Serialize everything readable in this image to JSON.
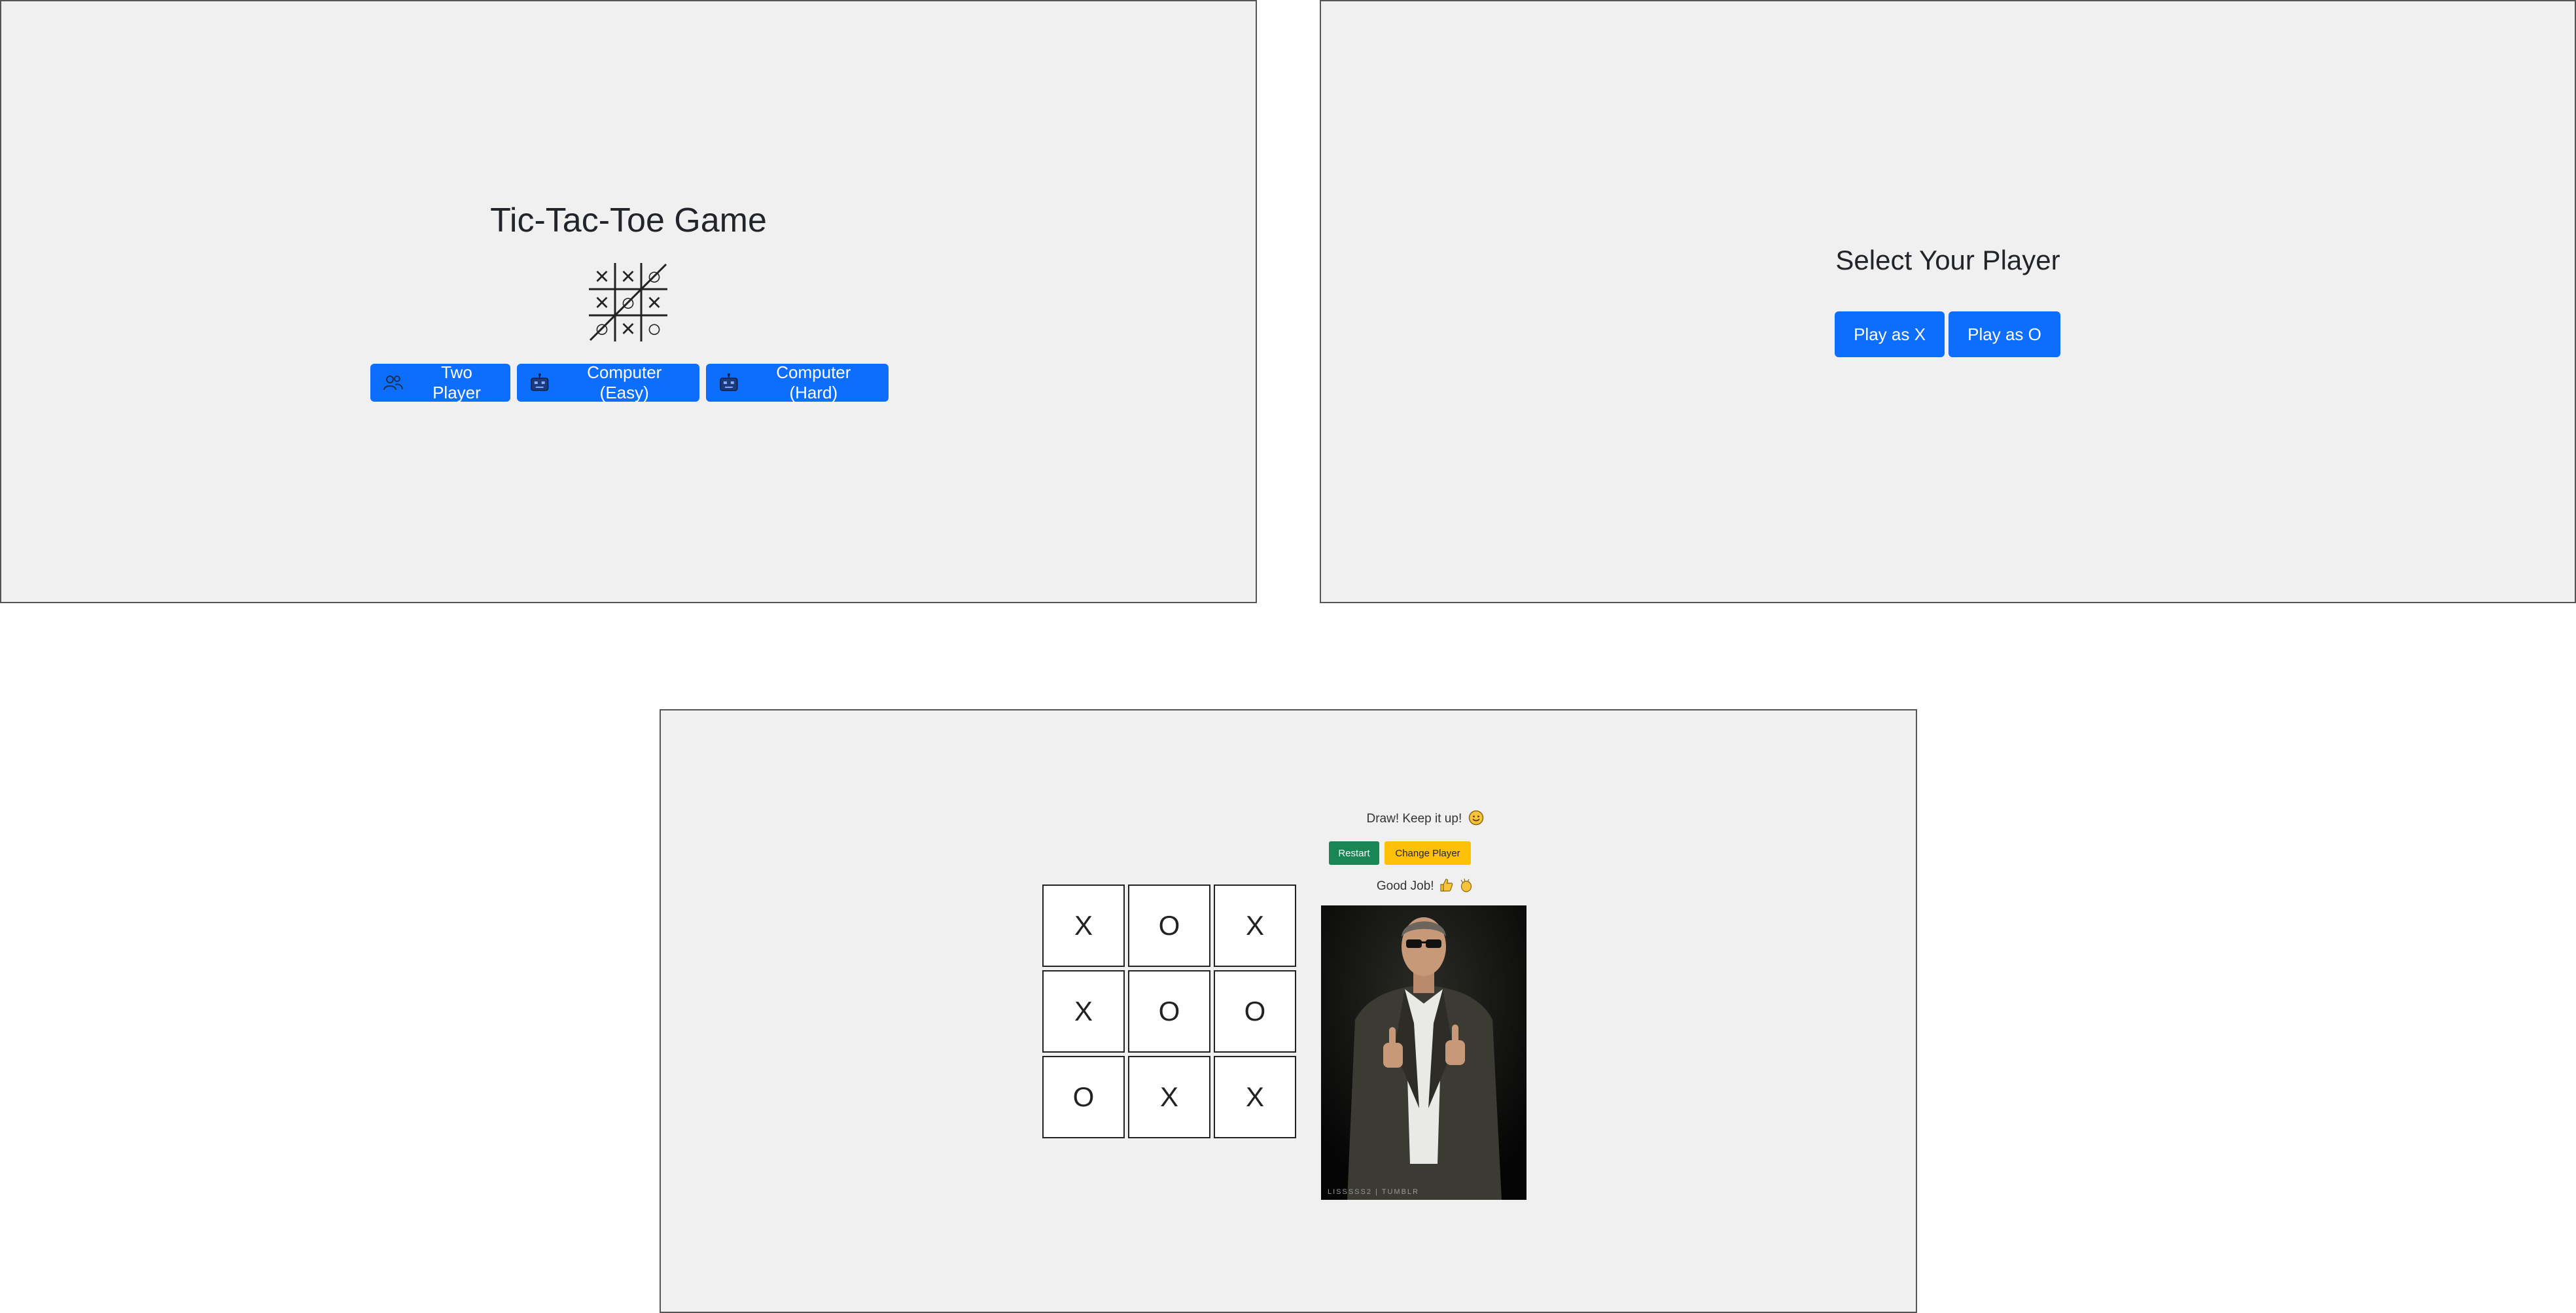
{
  "menu": {
    "title": "Tic-Tac-Toe Game",
    "logo_marks": [
      "×",
      "×",
      "○",
      "×",
      "○",
      "×",
      "○",
      "×",
      "○"
    ],
    "buttons": {
      "two_player": "Two Player",
      "computer_easy": "Computer (Easy)",
      "computer_hard": "Computer (Hard)"
    },
    "icons": {
      "two_player": "users-icon",
      "computer_easy": "robot-icon",
      "computer_hard": "robot-icon"
    }
  },
  "select": {
    "title": "Select Your Player",
    "play_x": "Play as X",
    "play_o": "Play as O"
  },
  "game": {
    "board": [
      "X",
      "O",
      "X",
      "X",
      "O",
      "O",
      "O",
      "X",
      "X"
    ],
    "status": "Draw! Keep it up!",
    "status_emoji": "smiling-face",
    "restart_label": "Restart",
    "change_player_label": "Change Player",
    "praise": "Good Job!",
    "praise_emojis": [
      "thumbs-up",
      "clapping-hands"
    ],
    "image_caption": "LISSSSS2 | TUMBLR"
  },
  "colors": {
    "panel_bg": "#f0f0f0",
    "primary": "#0d6efd",
    "success": "#198754",
    "warning": "#ffc107"
  }
}
